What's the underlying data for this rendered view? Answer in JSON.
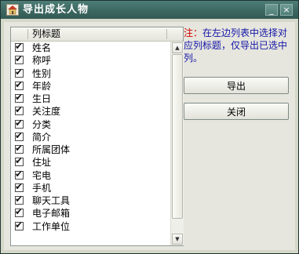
{
  "window": {
    "title": "导出成长人物",
    "minimize_glyph": "_",
    "close_glyph": "×",
    "app_icon": "house-icon"
  },
  "list": {
    "header": "列标题",
    "items": [
      {
        "label": "姓名",
        "checked": true
      },
      {
        "label": "称呼",
        "checked": true
      },
      {
        "label": "性别",
        "checked": true
      },
      {
        "label": "年龄",
        "checked": true
      },
      {
        "label": "生日",
        "checked": true
      },
      {
        "label": "关注度",
        "checked": true
      },
      {
        "label": "分类",
        "checked": true
      },
      {
        "label": "简介",
        "checked": true
      },
      {
        "label": "所属团体",
        "checked": true
      },
      {
        "label": "住址",
        "checked": true
      },
      {
        "label": "宅电",
        "checked": true
      },
      {
        "label": "手机",
        "checked": true
      },
      {
        "label": "聊天工具",
        "checked": true
      },
      {
        "label": "电子邮箱",
        "checked": true
      },
      {
        "label": "工作单位",
        "checked": true
      }
    ]
  },
  "note": {
    "prefix": "注：",
    "text": "在左边列表中选择对应列标题，仅导出已选中列。"
  },
  "buttons": {
    "export_label": "导出",
    "close_label": "关闭"
  },
  "check_glyph": "✔",
  "colors": {
    "titlebar": "#3b6660",
    "note_prefix": "#d40000",
    "note_text": "#1414a8"
  }
}
